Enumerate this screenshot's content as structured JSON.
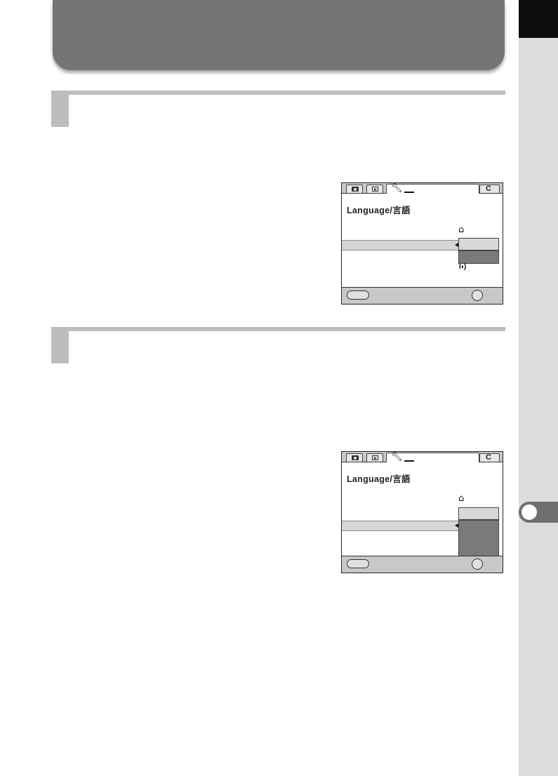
{
  "screens": [
    {
      "title": "Language/言語",
      "icons": {
        "capture_tab": "camera-icon",
        "playback_tab": "play-icon",
        "setup_tab": "wrench-icon",
        "custom_tab": "C",
        "home": "home-icon",
        "sound": "speaker-icon",
        "menu_button": "menu-button-icon",
        "ok_button": "ok-button-icon"
      }
    },
    {
      "title": "Language/言語",
      "icons": {
        "capture_tab": "camera-icon",
        "playback_tab": "play-icon",
        "setup_tab": "wrench-icon",
        "custom_tab": "C",
        "home": "home-icon",
        "menu_button": "menu-button-icon",
        "ok_button": "ok-button-icon"
      }
    }
  ],
  "colors": {
    "banner": "#747474",
    "side_strip": "#dcdcdc",
    "chapter_tab": "#6e6e6e",
    "step_bar": "#bdbdbd",
    "highlight": "#d6d6d6",
    "dropdown_dark": "#7a7a7a"
  }
}
